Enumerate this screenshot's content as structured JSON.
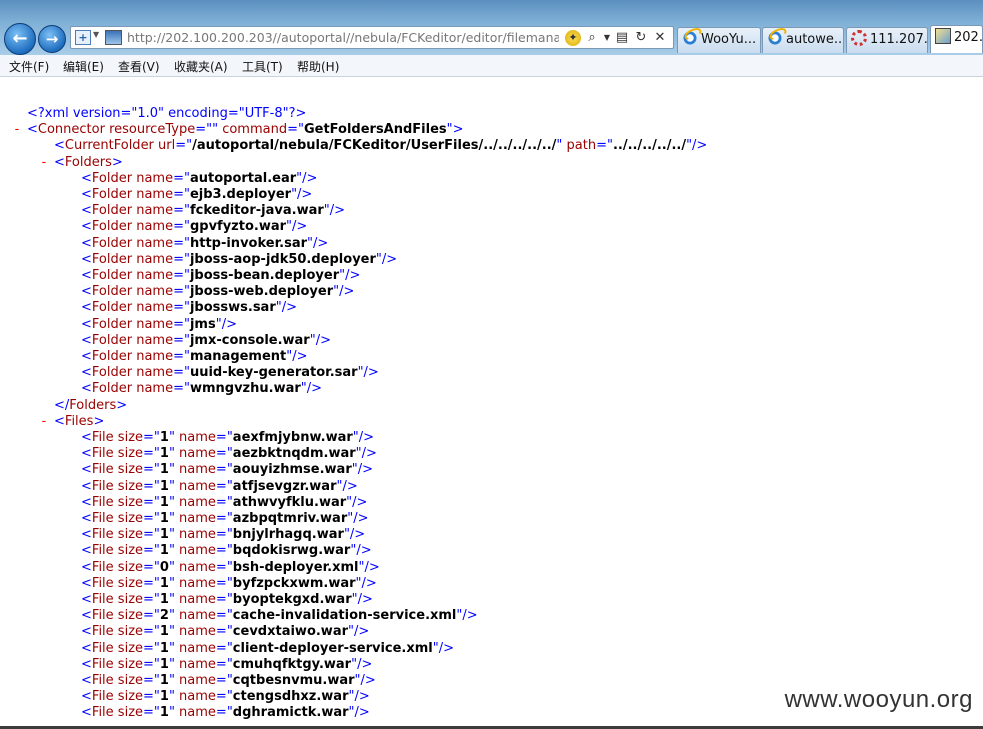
{
  "browser": {
    "address_url_host": "http://202.100.200.203/",
    "address_url_path": "/autoportal//nebula/FCKeditor/editor/filemanager/l",
    "tabs": [
      {
        "label": "WooYu...",
        "icon": "ie-icon"
      },
      {
        "label": "autowe...",
        "icon": "ie-icon"
      },
      {
        "label": "111.207...",
        "icon": "loading-icon"
      },
      {
        "label": "202...",
        "icon": "document-icon"
      }
    ]
  },
  "menu": [
    "文件(F)",
    "编辑(E)",
    "查看(V)",
    "收藏夹(A)",
    "工具(T)",
    "帮助(H)"
  ],
  "xml": {
    "decl": "<?xml version=\"1.0\" encoding=\"UTF-8\"?>",
    "connector": {
      "resourceType": "",
      "command": "GetFoldersAndFiles"
    },
    "current_folder": {
      "url": "/autoportal/nebula/FCKeditor/UserFiles/../../../../../",
      "path": "../../../../../"
    },
    "folders": [
      "autoportal.ear",
      "ejb3.deployer",
      "fckeditor-java.war",
      "gpvfyzto.war",
      "http-invoker.sar",
      "jboss-aop-jdk50.deployer",
      "jboss-bean.deployer",
      "jboss-web.deployer",
      "jbossws.sar",
      "jms",
      "jmx-console.war",
      "management",
      "uuid-key-generator.sar",
      "wmngvzhu.war"
    ],
    "files": [
      {
        "size": "1",
        "name": "aexfmjybnw.war"
      },
      {
        "size": "1",
        "name": "aezbktnqdm.war"
      },
      {
        "size": "1",
        "name": "aouyizhmse.war"
      },
      {
        "size": "1",
        "name": "atfjsevgzr.war"
      },
      {
        "size": "1",
        "name": "athwvyfklu.war"
      },
      {
        "size": "1",
        "name": "azbpqtmriv.war"
      },
      {
        "size": "1",
        "name": "bnjylrhagq.war"
      },
      {
        "size": "1",
        "name": "bqdokisrwg.war"
      },
      {
        "size": "0",
        "name": "bsh-deployer.xml"
      },
      {
        "size": "1",
        "name": "byfzpckxwm.war"
      },
      {
        "size": "1",
        "name": "byoptekgxd.war"
      },
      {
        "size": "2",
        "name": "cache-invalidation-service.xml"
      },
      {
        "size": "1",
        "name": "cevdxtaiwo.war"
      },
      {
        "size": "1",
        "name": "client-deployer-service.xml"
      },
      {
        "size": "1",
        "name": "cmuhqfktgy.war"
      },
      {
        "size": "1",
        "name": "cqtbesnvmu.war"
      },
      {
        "size": "1",
        "name": "ctengsdhxz.war"
      },
      {
        "size": "1",
        "name": "dghramictk.war"
      }
    ]
  },
  "watermark": "www.wooyun.org"
}
